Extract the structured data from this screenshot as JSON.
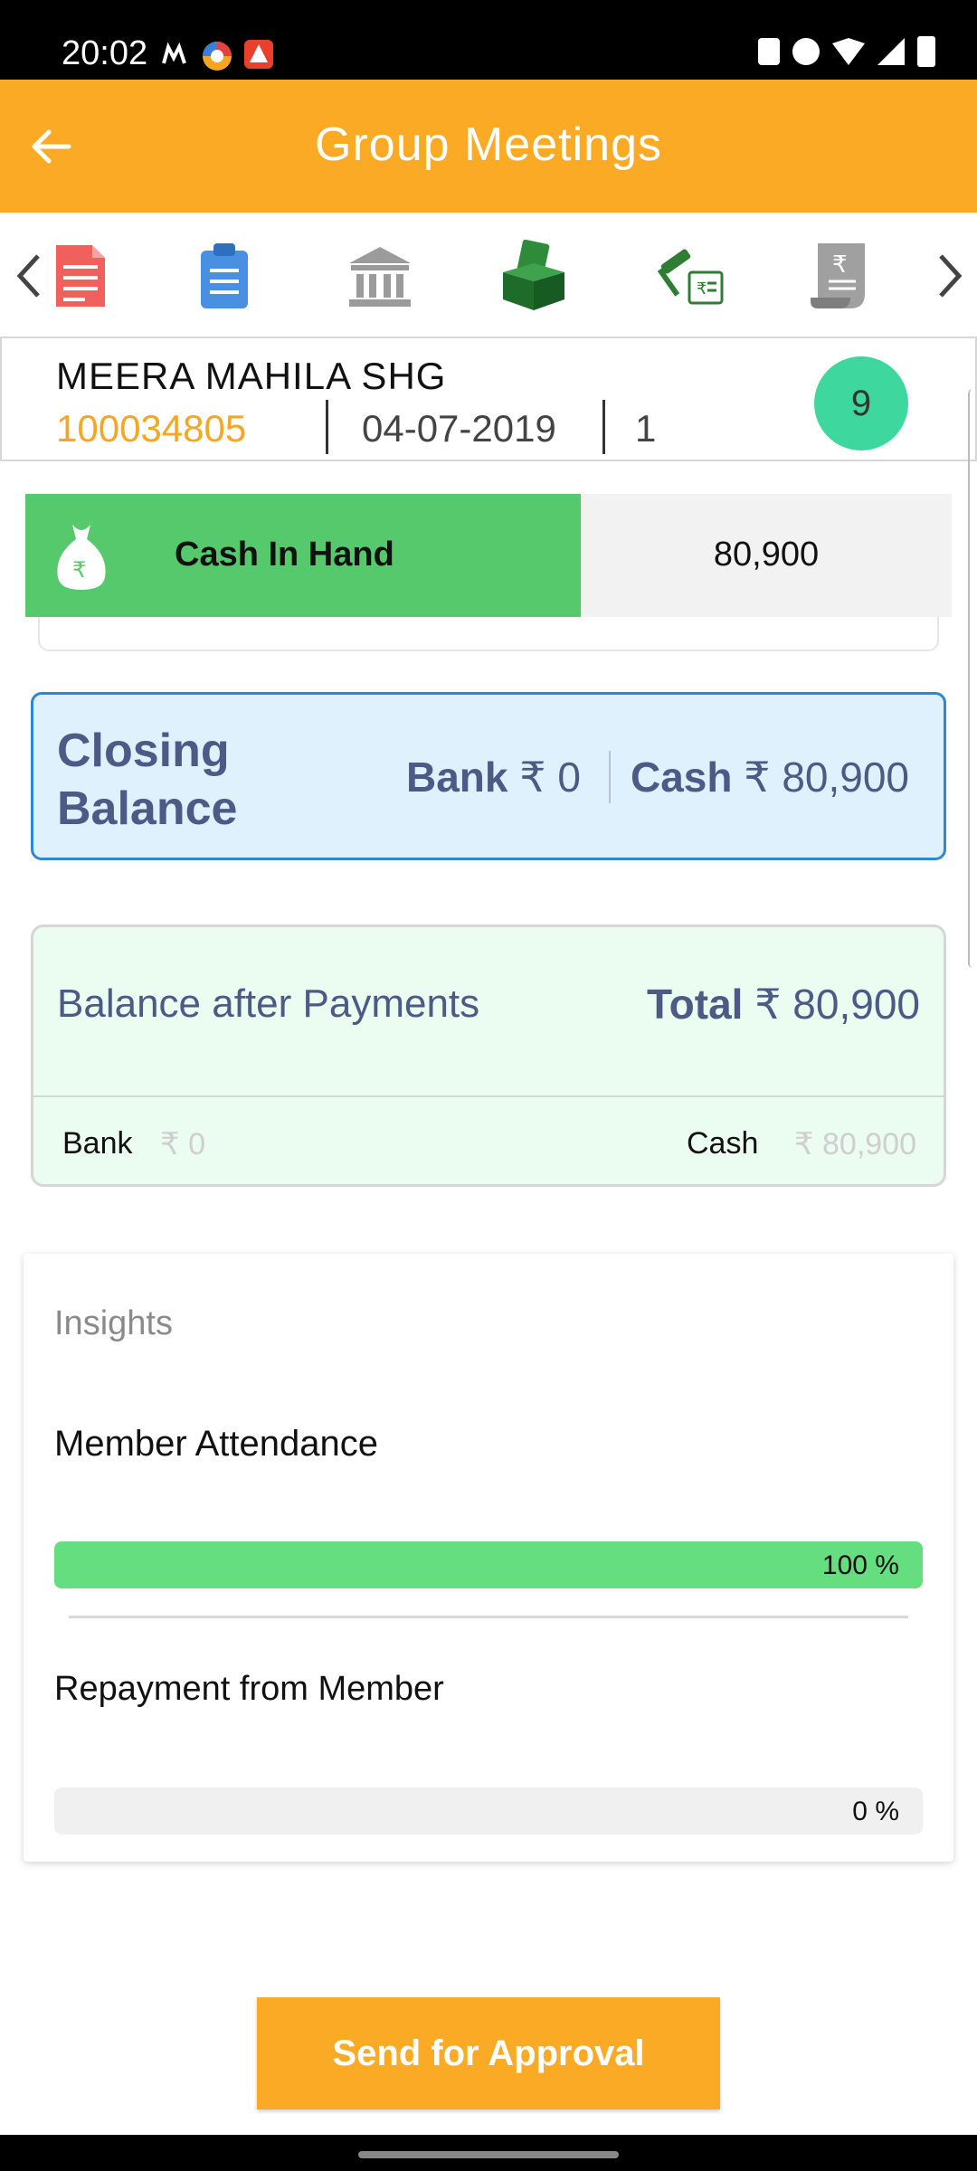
{
  "status_bar": {
    "time": "20:02",
    "notification_icons": [
      "m-icon",
      "browser-icon",
      "app-icon"
    ],
    "right_icons": [
      "battery-saver-icon",
      "alarm-icon",
      "wifi-icon",
      "signal-icon",
      "battery-icon"
    ]
  },
  "app_bar": {
    "title": "Group Meetings",
    "back_icon": "back-arrow-icon",
    "background": "#FBAA25"
  },
  "tabs": {
    "icons": [
      "document-icon",
      "clipboard-icon",
      "bank-icon",
      "cash-box-icon",
      "loan-gavel-icon",
      "receipt-icon"
    ],
    "active_index": 3
  },
  "group": {
    "name": "MEERA MAHILA SHG",
    "id": "100034805",
    "date": "04-07-2019",
    "meeting_number": "1",
    "badge": "9"
  },
  "cash_in_hand": {
    "label": "Cash In Hand",
    "value": "80,900"
  },
  "closing_balance": {
    "label_line1": "Closing",
    "label_line2": "Balance",
    "bank_label": "Bank",
    "bank_value": "₹ 0",
    "cash_label": "Cash",
    "cash_value": "₹ 80,900"
  },
  "balance_after_payments": {
    "label": "Balance after Payments",
    "total_label": "Total",
    "total_value": "₹ 80,900",
    "bank_label": "Bank",
    "bank_value": "₹ 0",
    "cash_label": "Cash",
    "cash_value": "₹ 80,900"
  },
  "insights": {
    "heading": "Insights",
    "metrics": [
      {
        "label": "Member Attendance",
        "percent_text": "100 %",
        "percent": 100
      },
      {
        "label": "Repayment from Member",
        "percent_text": "0 %",
        "percent": 0
      }
    ]
  },
  "actions": {
    "send_label": "Send for Approval"
  },
  "colors": {
    "accent": "#FBAA25",
    "green": "#56C96D",
    "badge": "#3ED79E",
    "closing_bg": "#DFF1FD",
    "closing_border": "#2F86D4",
    "bap_bg": "#EBFCF0",
    "progress_fill": "#65DE7F"
  }
}
